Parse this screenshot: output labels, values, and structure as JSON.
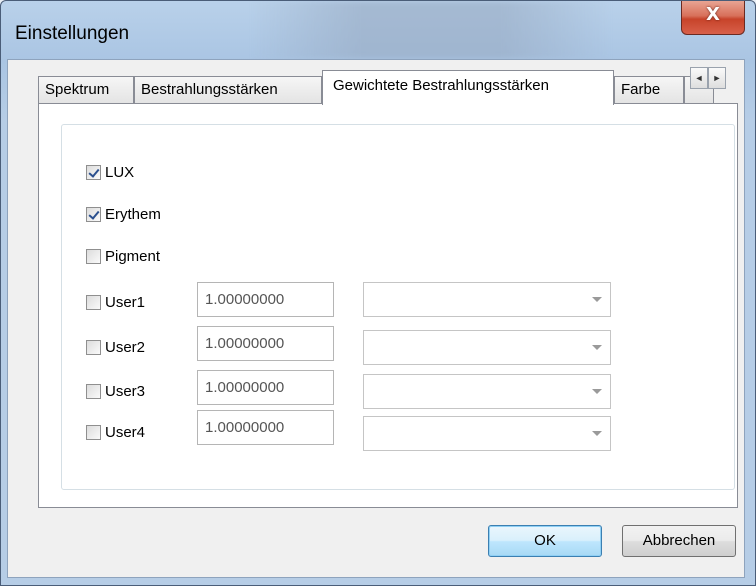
{
  "window": {
    "title": "Einstellungen",
    "close_label": "X"
  },
  "tabs": [
    {
      "label": "Spektrum"
    },
    {
      "label": "Bestrahlungsstärken"
    },
    {
      "label": "Gewichtete Bestrahlungsstärken"
    },
    {
      "label": "Farbe"
    }
  ],
  "tab_scroll": {
    "left": "◄",
    "right": "►"
  },
  "options": {
    "lux": {
      "label": "LUX",
      "checked": true
    },
    "erythem": {
      "label": "Erythem",
      "checked": true
    },
    "pigment": {
      "label": "Pigment",
      "checked": false
    }
  },
  "users": [
    {
      "label": "User1",
      "value": "1.00000000",
      "checked": false
    },
    {
      "label": "User2",
      "value": "1.00000000",
      "checked": false
    },
    {
      "label": "User3",
      "value": "1.00000000",
      "checked": false
    },
    {
      "label": "User4",
      "value": "1.00000000",
      "checked": false
    }
  ],
  "buttons": {
    "ok": "OK",
    "cancel": "Abbrechen"
  }
}
